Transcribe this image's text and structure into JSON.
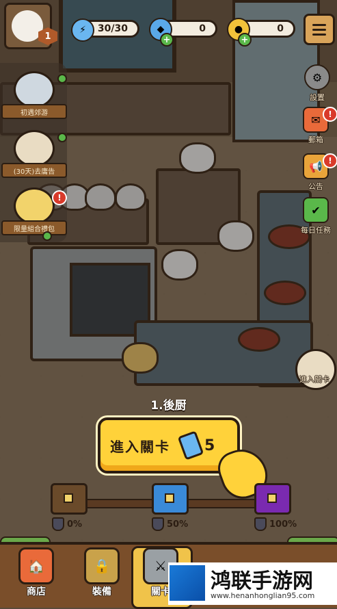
{
  "top_bar": {
    "level": "1",
    "energy": "30/30",
    "gems": "0",
    "coins": "0"
  },
  "left_events": [
    {
      "label": "初遇郊游"
    },
    {
      "label": "(30天)去庸告"
    },
    {
      "label": "限量組合禮包"
    }
  ],
  "right_menu": [
    {
      "label": "設置",
      "icon": "gear-icon"
    },
    {
      "label": "郵箱",
      "icon": "mail-icon"
    },
    {
      "label": "公告",
      "icon": "megaphone-icon"
    },
    {
      "label": "每日任務",
      "icon": "checklist-icon"
    },
    {
      "label": "進入關卡",
      "icon": "stage-icon"
    }
  ],
  "stage": {
    "title": "1.後厨",
    "enter_label": "進入關卡",
    "cost": "5"
  },
  "progress": {
    "fill_fraction": 0,
    "milestones": [
      {
        "label": "0%",
        "chest_color": "#6a4a2a"
      },
      {
        "label": "50%",
        "chest_color": "#3a8ad8"
      },
      {
        "label": "100%",
        "chest_color": "#7a2ab0"
      }
    ]
  },
  "bottom_nav": [
    {
      "label": "商店",
      "icon": "shop-icon"
    },
    {
      "label": "裝備",
      "icon": "lock-icon"
    },
    {
      "label": "關卡",
      "icon": "swords-icon"
    }
  ],
  "watermark": {
    "text": "鸿联手游网",
    "url": "www.henanhonglian95.com"
  },
  "colors": {
    "button_yellow": "#ffd23a",
    "outline": "#2b1d12",
    "nav_wood": "#7a4e2a",
    "alert_red": "#d93a2a",
    "green_dot": "#5ab84a"
  }
}
